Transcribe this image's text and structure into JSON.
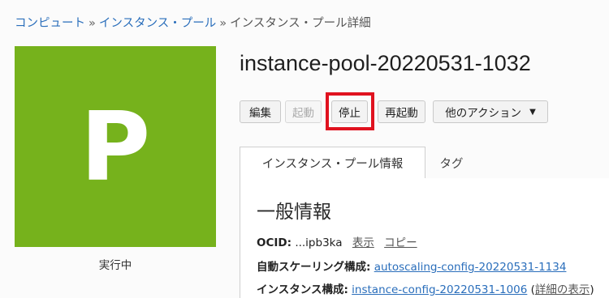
{
  "breadcrumb": {
    "compute": "コンピュート",
    "sep1": "»",
    "instance_pools": "インスタンス・プール",
    "sep2": "»",
    "current": "インスタンス・プール詳細"
  },
  "avatar": {
    "letter": "P",
    "color": "#76b21c"
  },
  "status": "実行中",
  "title": "instance-pool-20220531-1032",
  "actions": {
    "edit": "編集",
    "start": "起動",
    "stop": "停止",
    "reboot": "再起動",
    "more": "他のアクション",
    "more_caret": "▼"
  },
  "tabs": {
    "info": "インスタンス・プール情報",
    "tags": "タグ"
  },
  "general": {
    "heading": "一般情報",
    "ocid_label": "OCID:",
    "ocid_value": "...ipb3ka",
    "ocid_show": "表示",
    "ocid_copy": "コピー",
    "autoscaling_label": "自動スケーリング構成:",
    "autoscaling_value": "autoscaling-config-20220531-1134",
    "instance_config_label": "インスタンス構成:",
    "instance_config_value": "instance-config-20220531-1006",
    "details_open": "(",
    "details_link": "詳細の表示",
    "details_close": ")"
  },
  "colors": {
    "link": "#2a6ebb",
    "highlight": "#e0121f",
    "brand": "#76b21c"
  }
}
